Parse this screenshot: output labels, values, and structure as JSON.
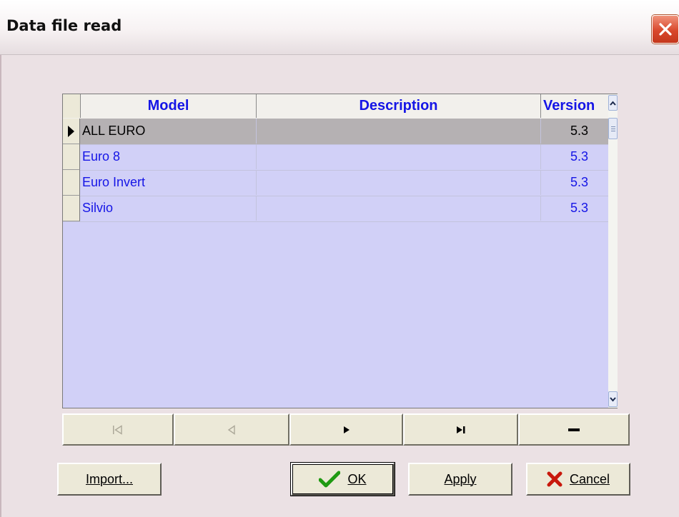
{
  "window": {
    "title": "Data file read"
  },
  "grid": {
    "columns": [
      "Model",
      "Description",
      "Version"
    ],
    "rows": [
      {
        "model": "ALL EURO",
        "description": "",
        "version": "5.3",
        "selected": true
      },
      {
        "model": "Euro 8",
        "description": "",
        "version": "5.3",
        "selected": false
      },
      {
        "model": "Euro Invert",
        "description": "",
        "version": "5.3",
        "selected": false
      },
      {
        "model": "Silvio",
        "description": "",
        "version": "5.3",
        "selected": false
      }
    ]
  },
  "navigator": {
    "buttons": [
      {
        "name": "first-record",
        "icon": "skip-first-icon",
        "enabled": false
      },
      {
        "name": "prior-record",
        "icon": "triangle-left-icon",
        "enabled": false
      },
      {
        "name": "next-record",
        "icon": "triangle-right-icon",
        "enabled": true
      },
      {
        "name": "last-record",
        "icon": "skip-last-icon",
        "enabled": true
      },
      {
        "name": "delete-record",
        "icon": "minus-icon",
        "enabled": true
      }
    ]
  },
  "buttons": {
    "import": "Import...",
    "ok": "OK",
    "apply": "Apply",
    "cancel": "Cancel"
  },
  "colors": {
    "grid_background": "#d1d0f7",
    "header_text": "#1515e6",
    "selected_row": "#b5b1b3",
    "ok_check": "#1f9a12",
    "cancel_x": "#c8180c"
  }
}
